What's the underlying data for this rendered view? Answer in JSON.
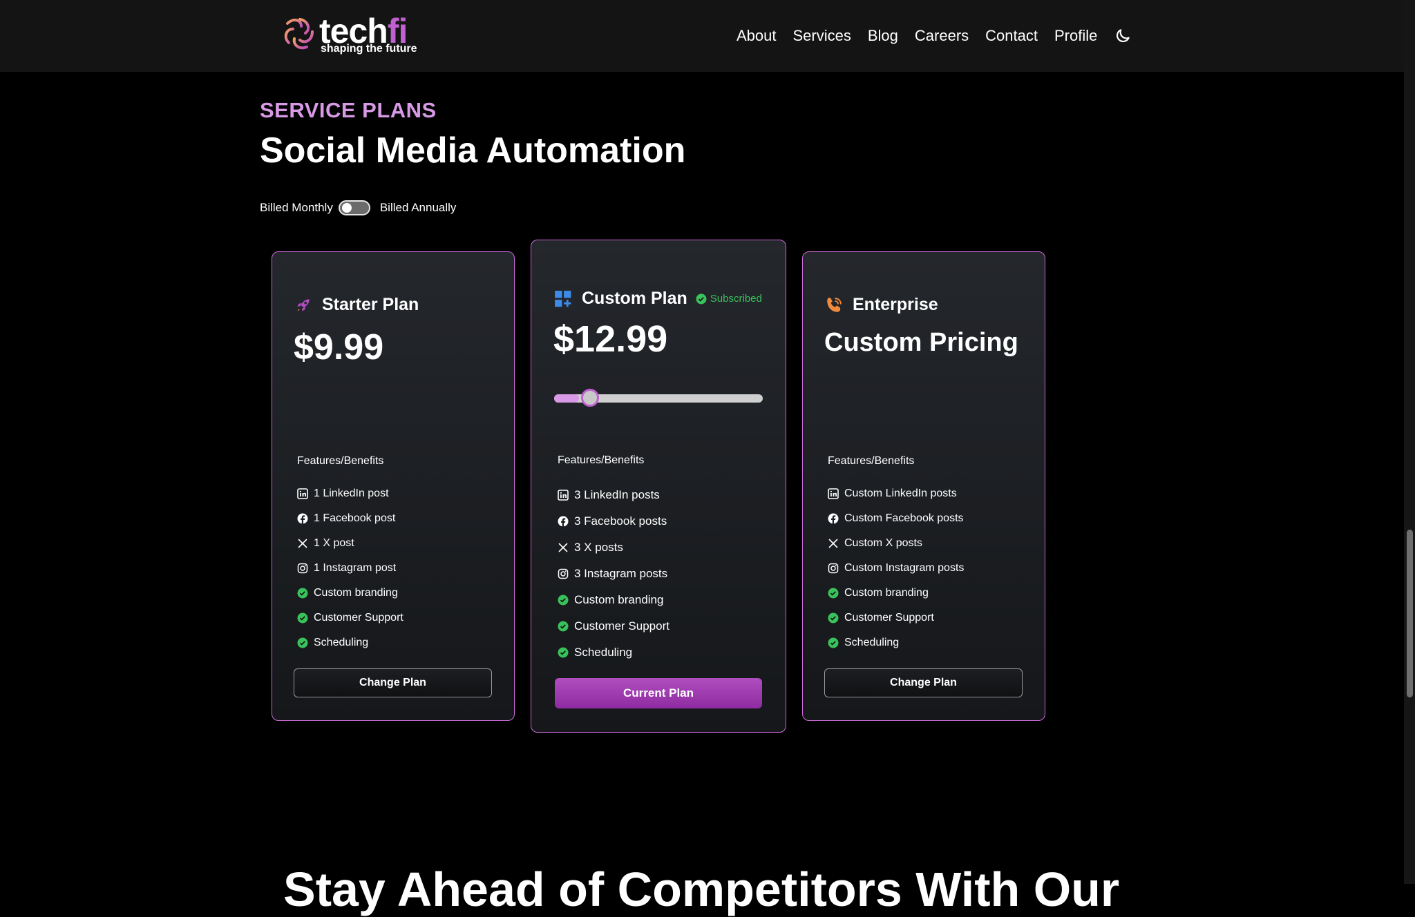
{
  "brand": {
    "name_a": "tech",
    "name_b": "fi",
    "tagline": "shaping the future",
    "accent": "#c061d0"
  },
  "nav": {
    "items": [
      "About",
      "Services",
      "Blog",
      "Careers",
      "Contact",
      "Profile"
    ],
    "theme_icon": "moon-icon"
  },
  "section": {
    "eyebrow": "SERVICE PLANS",
    "title": "Social Media Automation"
  },
  "billing": {
    "monthly_label": "Billed Monthly",
    "annual_label": "Billed Annually",
    "annual_selected": false
  },
  "plans": [
    {
      "name": "Starter Plan",
      "icon": "rocket-icon",
      "price": "$9.99",
      "features_title": "Features/Benefits",
      "features": [
        {
          "icon": "linkedin-icon",
          "text": "1 LinkedIn post"
        },
        {
          "icon": "facebook-icon",
          "text": "1 Facebook post"
        },
        {
          "icon": "x-icon",
          "text": "1 X post"
        },
        {
          "icon": "instagram-icon",
          "text": "1 Instagram post"
        },
        {
          "icon": "check-circle-icon",
          "text": "Custom branding"
        },
        {
          "icon": "check-circle-icon",
          "text": "Customer Support"
        },
        {
          "icon": "check-circle-icon",
          "text": "Scheduling"
        }
      ],
      "button": "Change Plan"
    },
    {
      "name": "Custom Plan",
      "icon": "apps-add-icon",
      "badge": "Subscribed",
      "price": "$12.99",
      "slider_value": 0.12,
      "features_title": "Features/Benefits",
      "features": [
        {
          "icon": "linkedin-icon",
          "text": "3 LinkedIn posts"
        },
        {
          "icon": "facebook-icon",
          "text": "3 Facebook posts"
        },
        {
          "icon": "x-icon",
          "text": "3 X posts"
        },
        {
          "icon": "instagram-icon",
          "text": "3 Instagram posts"
        },
        {
          "icon": "check-circle-icon",
          "text": "Custom branding"
        },
        {
          "icon": "check-circle-icon",
          "text": "Customer Support"
        },
        {
          "icon": "check-circle-icon",
          "text": "Scheduling"
        }
      ],
      "button": "Current Plan"
    },
    {
      "name": "Enterprise",
      "icon": "phone-icon",
      "price": "Custom Pricing",
      "features_title": "Features/Benefits",
      "features": [
        {
          "icon": "linkedin-icon",
          "text": "Custom LinkedIn posts"
        },
        {
          "icon": "facebook-icon",
          "text": "Custom Facebook posts"
        },
        {
          "icon": "x-icon",
          "text": "Custom X posts"
        },
        {
          "icon": "instagram-icon",
          "text": "Custom Instagram posts"
        },
        {
          "icon": "check-circle-icon",
          "text": "Custom branding"
        },
        {
          "icon": "check-circle-icon",
          "text": "Customer Support"
        },
        {
          "icon": "check-circle-icon",
          "text": "Scheduling"
        }
      ],
      "button": "Change Plan"
    }
  ],
  "next_section": {
    "title": "Stay Ahead of Competitors With Our"
  },
  "colors": {
    "check": "#39c25b",
    "border": "#cc6bd8",
    "eyebrow": "#d89ae6"
  }
}
